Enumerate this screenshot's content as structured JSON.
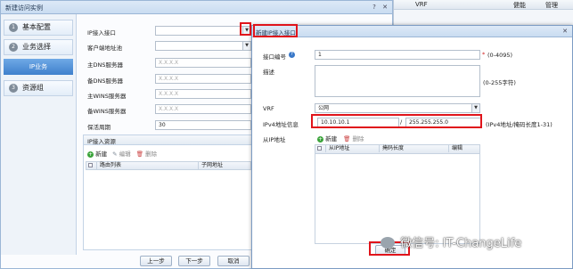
{
  "bg_window": {
    "col_vrf": "VRF",
    "col_health": "健能",
    "col_mgmt": "管理"
  },
  "main_dialog": {
    "title": "新建访问实例",
    "sidebar": [
      {
        "num": "1",
        "label": "基本配置"
      },
      {
        "num": "2",
        "label": "业务选择"
      },
      {
        "sub": "IP业务"
      },
      {
        "num": "3",
        "label": "资源组"
      }
    ],
    "form": {
      "ip_access_if": {
        "label": "IP接入接口",
        "value": ""
      },
      "client_pool": {
        "label": "客户端地址池",
        "value": ""
      },
      "primary_dns": {
        "label": "主DNS服务器",
        "placeholder": "X.X.X.X"
      },
      "secondary_dns": {
        "label": "备DNS服务器",
        "placeholder": "X.X.X.X"
      },
      "primary_wins": {
        "label": "主WINS服务器",
        "placeholder": "X.X.X.X"
      },
      "secondary_wins": {
        "label": "备WINS服务器",
        "placeholder": "X.X.X.X"
      },
      "keepalive": {
        "label": "保活周期",
        "value": "30"
      }
    },
    "resource_group": {
      "title": "IP接入资源",
      "toolbar": {
        "new": "新建",
        "edit": "编辑",
        "delete": "删除"
      },
      "columns": [
        "路由列表",
        "子网地址"
      ]
    },
    "buttons": {
      "prev": "上一步",
      "next": "下一步",
      "cancel": "取消"
    }
  },
  "sub_dialog": {
    "title": "新建IP接入接口",
    "if_number": {
      "label": "接口编号",
      "value": "1",
      "required": "*",
      "hint": "(0-4095)"
    },
    "description": {
      "label": "描述",
      "hint": "(0-255字符)"
    },
    "vrf": {
      "label": "VRF",
      "value": "公网"
    },
    "ipv4": {
      "label": "IPv4地址信息",
      "address": "10.10.10.1",
      "separator": "/",
      "mask": "255.255.255.0",
      "hint": "(IPv4地址/掩码长度1-31)"
    },
    "secondary_ip": {
      "label": "从IP地址",
      "toolbar": {
        "new": "新建",
        "delete": "删除"
      },
      "columns": [
        "从IP地址",
        "掩码长度",
        "编辑"
      ]
    },
    "ok_button": "确定"
  },
  "watermark": "微信号: IT-ChangeLife",
  "colors": {
    "highlight_red": "#e0141b",
    "title_bar": "#c9dcf1",
    "selected_step": "#3f80cc"
  }
}
